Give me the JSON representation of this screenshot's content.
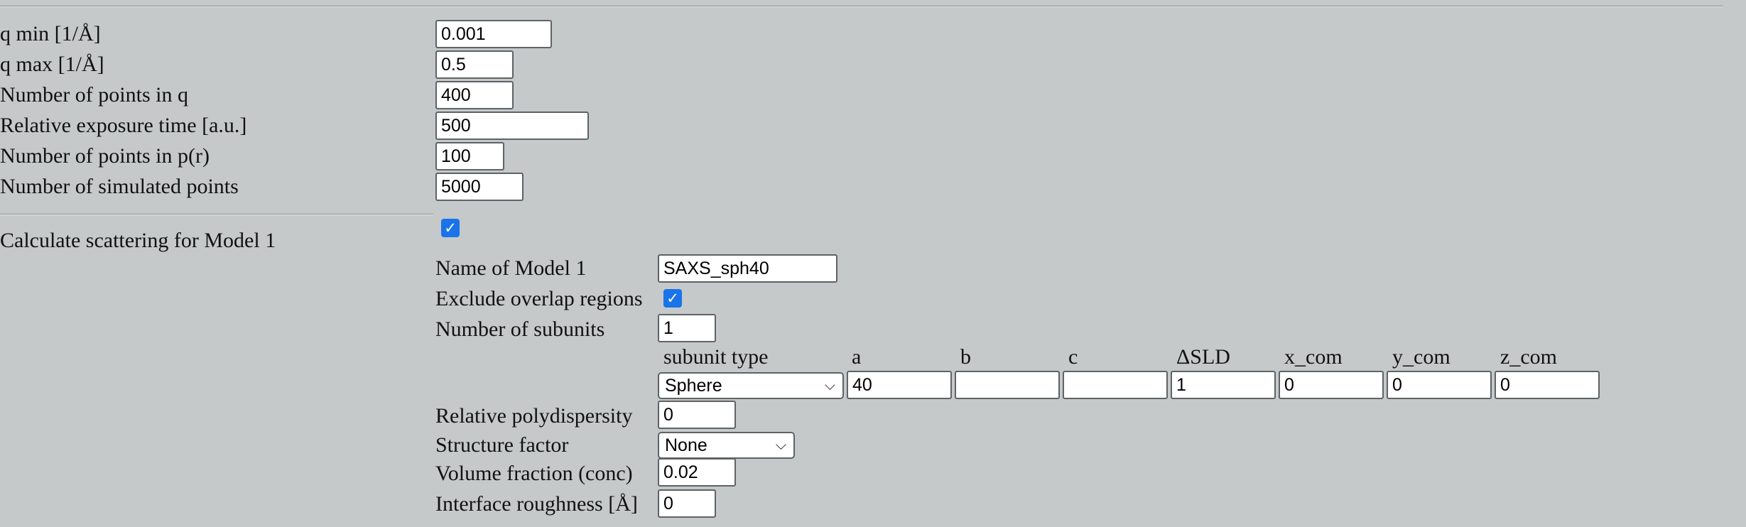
{
  "settings": {
    "qmin": {
      "label": "q min [1/Å]",
      "value": "0.001"
    },
    "qmax": {
      "label": "q max [1/Å]",
      "value": "0.5"
    },
    "nq": {
      "label": "Number of points in q",
      "value": "400"
    },
    "exposure": {
      "label": "Relative exposure time [a.u.]",
      "value": "500"
    },
    "npr": {
      "label": "Number of points in p(r)",
      "value": "100"
    },
    "nsim": {
      "label": "Number of simulated points",
      "value": "5000"
    }
  },
  "model": {
    "calc_label": "Calculate scattering for Model 1",
    "calc_checked": true,
    "name_label": "Name of Model 1",
    "name_value": "SAXS_sph40",
    "exclude_label": "Exclude overlap regions",
    "exclude_checked": true,
    "nsub_label": "Number of subunits",
    "nsub_value": "1",
    "subunit_headers": [
      "subunit type",
      "a",
      "b",
      "c",
      "ΔSLD",
      "x_com",
      "y_com",
      "z_com"
    ],
    "subunit_row": {
      "type": "Sphere",
      "a": "40",
      "b": "",
      "c": "",
      "dsld": "1",
      "x_com": "0",
      "y_com": "0",
      "z_com": "0"
    },
    "polydisp_label": "Relative polydispersity",
    "polydisp_value": "0",
    "sf_label": "Structure factor",
    "sf_value": "None",
    "volfrac_label": "Volume fraction (conc)",
    "volfrac_value": "0.02",
    "rough_label": "Interface roughness [Å]",
    "rough_value": "0"
  },
  "icons": {
    "check": "checkmark-icon",
    "dropdown": "chevron-down-icon"
  },
  "colors": {
    "background": "#c5c9ca",
    "checkbox": "#1a73e8"
  }
}
